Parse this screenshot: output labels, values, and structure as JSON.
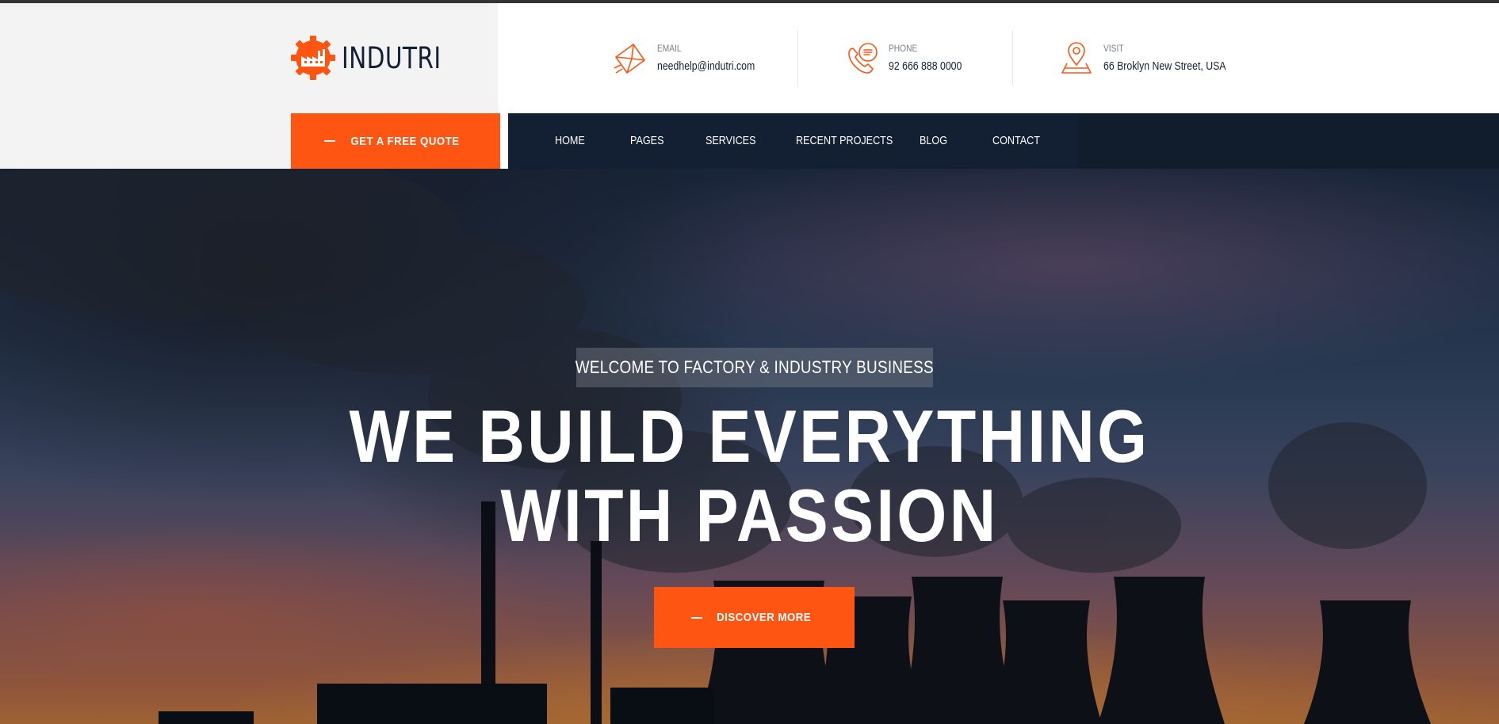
{
  "brand": {
    "name": "INDUTRI",
    "accent": "#ff5513",
    "dark": "#132033"
  },
  "contacts": [
    {
      "icon": "envelope-icon",
      "label": "Email",
      "value": "needhelp@indutri.com"
    },
    {
      "icon": "phone-icon",
      "label": "Phone",
      "value": "92 666 888 0000"
    },
    {
      "icon": "map-pin-icon",
      "label": "Visit",
      "value": "66 Broklyn New Street, USA"
    }
  ],
  "quote_button": {
    "label": "GET A FREE QUOTE"
  },
  "nav": {
    "items": [
      "HOME",
      "PAGES",
      "SERVICES",
      "RECENT PROJECTS",
      "BLOG",
      "CONTACT"
    ]
  },
  "hero": {
    "tagline": "WELCOME TO FACTORY & INDUSTRY BUSINESS",
    "headline_line1": "WE BUILD EVERYTHING",
    "headline_line2": "WITH PASSION",
    "button_label": "DISCOVER MORE"
  }
}
